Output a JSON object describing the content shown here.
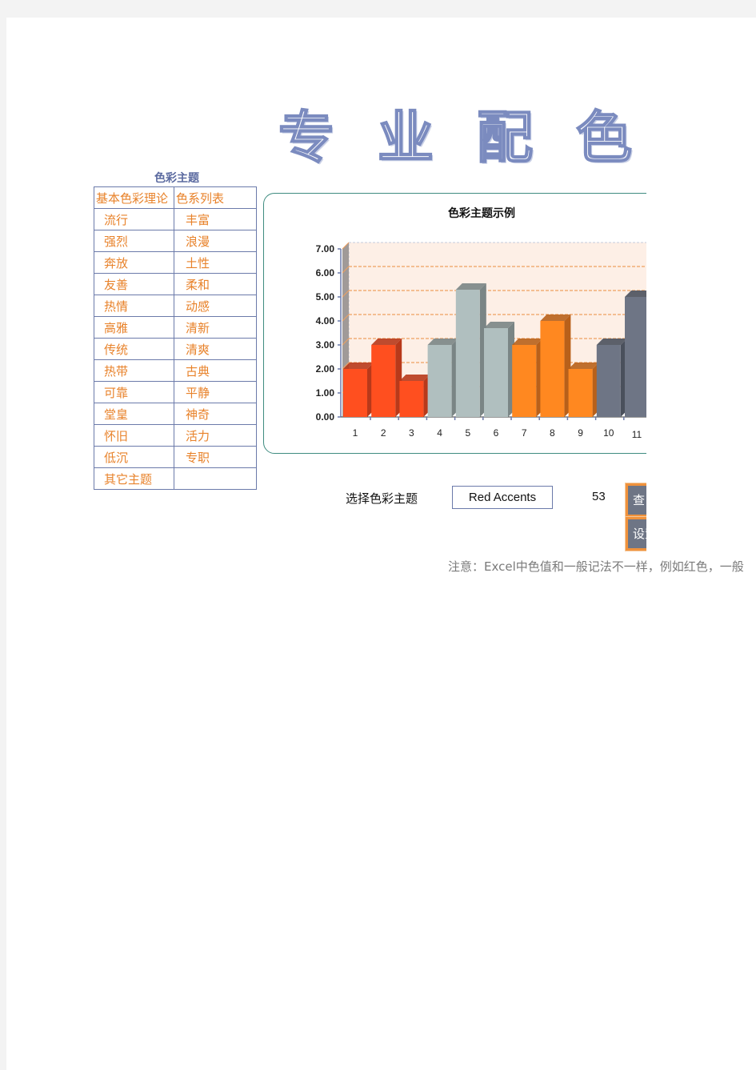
{
  "title": "专业配色",
  "theme_table": {
    "caption": "色彩主题",
    "headers": [
      "基本色彩理论",
      "色系列表"
    ],
    "rows": [
      [
        "流行",
        "丰富"
      ],
      [
        "强烈",
        "浪漫"
      ],
      [
        "奔放",
        "土性"
      ],
      [
        "友善",
        "柔和"
      ],
      [
        "热情",
        "动感"
      ],
      [
        "高雅",
        "清新"
      ],
      [
        "传统",
        "清爽"
      ],
      [
        "热带",
        "古典"
      ],
      [
        "可靠",
        "平静"
      ],
      [
        "堂皇",
        "神奇"
      ],
      [
        "怀旧",
        "活力"
      ],
      [
        "低沉",
        "专职"
      ],
      [
        "其它主题",
        ""
      ]
    ]
  },
  "controls": {
    "select_label": "选择色彩主题",
    "selected_theme": "Red  Accents",
    "theme_number": "53",
    "button1_label": "查",
    "button2_label": "设置"
  },
  "note": "注意：Excel中色值和一般记法不一样，例如红色，一般",
  "colors": {
    "accent_orange": "#e8822a",
    "table_border": "#6b7aaa",
    "chart_border": "#3f8c80",
    "plot_bg": "#fdefe6",
    "gridline": "#f0a060"
  },
  "chart_data": {
    "type": "bar",
    "title": "色彩主题示例",
    "xlabel": "",
    "ylabel": "",
    "ylim": [
      0,
      7
    ],
    "yticks": [
      "0.00",
      "1.00",
      "2.00",
      "3.00",
      "4.00",
      "5.00",
      "6.00",
      "7.00"
    ],
    "categories": [
      "1",
      "2",
      "3",
      "4",
      "5",
      "6",
      "7",
      "8",
      "9",
      "10",
      "11"
    ],
    "values": [
      2.0,
      3.0,
      1.5,
      3.0,
      5.3,
      3.7,
      3.0,
      4.0,
      2.0,
      3.0,
      5.0
    ],
    "bar_colors": [
      "#ff4f1f",
      "#ff4f1f",
      "#ff4f1f",
      "#b0bfbf",
      "#b0bfbf",
      "#b0bfbf",
      "#ff8820",
      "#ff8820",
      "#ff8820",
      "#6e7585",
      "#6e7585"
    ],
    "bar_side_colors": [
      "#b8391a",
      "#b8391a",
      "#b8391a",
      "#7a8585",
      "#7a8585",
      "#7a8585",
      "#b8601a",
      "#b8601a",
      "#b8601a",
      "#4a505c",
      "#4a505c"
    ],
    "grid": true,
    "style": "3d-column"
  }
}
